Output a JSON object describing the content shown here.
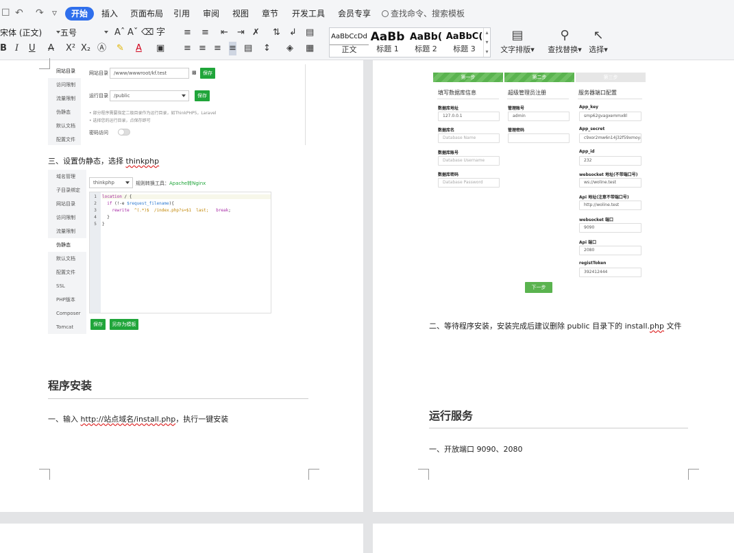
{
  "menubar": {
    "quick_access": [
      "☐",
      "↶",
      "↷",
      "▿"
    ],
    "tabs": [
      "开始",
      "插入",
      "页面布局",
      "引用",
      "审阅",
      "视图",
      "章节",
      "开发工具",
      "会员专享"
    ],
    "search_text": "查找命令、搜索模板"
  },
  "ribbon": {
    "font_name": "宋体 (正文)",
    "font_size": "五号",
    "styles": [
      {
        "sample": "AaBbCcDd",
        "name": "正文"
      },
      {
        "sample": "AaBb",
        "name": "标题 1"
      },
      {
        "sample": "AaBb(",
        "name": "标题 2"
      },
      {
        "sample": "AaBbC(",
        "name": "标题 3"
      }
    ],
    "text_layout": "文字排版",
    "find_replace": "查找替换",
    "select": "选择"
  },
  "left_page": {
    "shot1": {
      "sidebar": [
        "同站目录",
        "访问限制",
        "流量限制",
        "伪静态",
        "默认文档",
        "配置文件"
      ],
      "dir_label": "网站目录",
      "dir_value": "/www/wwwroot/kf.test",
      "run_label": "运行目录",
      "run_value": "/public",
      "save": "保存",
      "notes": [
        "部分程序需要指定二级目录作为运行目录，如ThinkPHP5，Laravel",
        "选择您的运行目录，点保存即可"
      ],
      "password_label": "密码访问"
    },
    "step3_prefix": "三、设置伪静态，选择 ",
    "step3_link": "thinkphp",
    "shot2": {
      "sidebar": [
        "域名管理",
        "子目录绑定",
        "网站目录",
        "访问限制",
        "流量限制",
        "伪静态",
        "默认文档",
        "配置文件",
        "SSL",
        "PHP版本",
        "Composer",
        "Tomcat"
      ],
      "select_value": "thinkphp",
      "convert_label": "规则转换工具：",
      "convert_link": "Apache转Nginx",
      "line_numbers": [
        "1",
        "2",
        "3",
        "4",
        "5"
      ],
      "save": "保存",
      "save_template": "另存为模板"
    },
    "section_title": "程序安装",
    "install_prefix": "一、输入 ",
    "install_url": "http://站点域名/install.php",
    "install_suffix": "，执行一键安装"
  },
  "right_page": {
    "steps": [
      "第一步",
      "第二步",
      "第三步"
    ],
    "col_headers": [
      "填写数据库信息",
      "超级管理员注册",
      "服务器端口配置"
    ],
    "db_fields": [
      {
        "label": "数据库地址",
        "value": "127.0.0.1",
        "placeholder": false
      },
      {
        "label": "数据库名",
        "value": "Database Name",
        "placeholder": true
      },
      {
        "label": "数据库账号",
        "value": "Database Username",
        "placeholder": true
      },
      {
        "label": "数据库密码",
        "value": "Database Password",
        "placeholder": true
      }
    ],
    "admin_fields": [
      {
        "label": "管理账号",
        "value": "admin"
      },
      {
        "label": "管理密码",
        "value": ""
      }
    ],
    "server_fields": [
      {
        "label": "App_key",
        "value": "smp62gvagxemmx8l"
      },
      {
        "label": "App_secret",
        "value": "c9xor2mw6n14j32f59xmoyac"
      },
      {
        "label": "App_id",
        "value": "232"
      },
      {
        "label": "websocket 地址(不带端口号)",
        "value": "ws://woline.test"
      },
      {
        "label": "Api 地址(注意不带端口号)",
        "value": "http://woline.test"
      },
      {
        "label": "websocket 端口",
        "value": "9090"
      },
      {
        "label": "Api 端口",
        "value": "2080"
      },
      {
        "label": "registToken",
        "value": "392412444"
      }
    ],
    "next_button": "下一步",
    "wait_prefix": "二、等待程序安装，安装完成后建议删除 public 目录下的 install.",
    "wait_suffix": "php",
    "wait_end": " 文件",
    "section_title": "运行服务",
    "ports_text": "一、开放端口 9090、2080"
  },
  "colors": {
    "accent": "#2f6fec",
    "bt_green": "#20a53a",
    "step_green": "#5ab34f"
  }
}
